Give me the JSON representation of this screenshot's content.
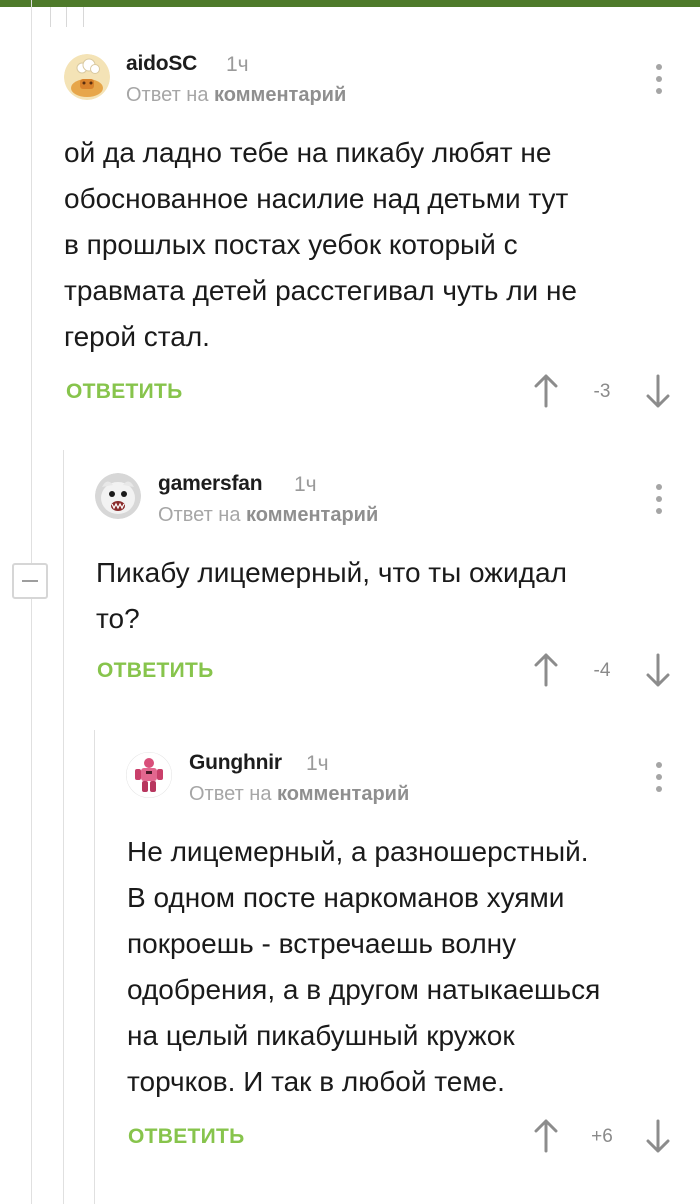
{
  "comments": [
    {
      "username": "aidoSC",
      "time": "1ч",
      "reply_prefix": "Ответ на",
      "reply_target": "комментарий",
      "text": "ой да ладно тебе на пикабу любят не\nобоснованное насилие над детьми тут\nв прошлых постах уебок который с\nтравмата детей расстегивал чуть ли не\nгерой стал.",
      "reply_label": "ОТВЕТИТЬ",
      "rating": "-3"
    },
    {
      "username": "gamersfan",
      "time": "1ч",
      "reply_prefix": "Ответ на",
      "reply_target": "комментарий",
      "text": "Пикабу лицемерный, что ты ожидал\nто?",
      "reply_label": "ОТВЕТИТЬ",
      "rating": "-4"
    },
    {
      "username": "Gunghnir",
      "time": "1ч",
      "reply_prefix": "Ответ на",
      "reply_target": "комментарий",
      "text": "Не лицемерный, а разношерстный.\nВ одном посте наркоманов хуями\nпокроешь - встречаешь волну\nодобрения, а в другом натыкаешься\nна целый пикабушный кружок\nторчков. И так в любой теме.",
      "reply_label": "ОТВЕТИТЬ",
      "rating": "+6"
    }
  ],
  "colors": {
    "accent_bar": "#4e7a2a",
    "reply_green": "#87c44c",
    "muted_text": "#9a9a9a"
  },
  "icons": {
    "menu": "more-vertical-icon",
    "upvote": "arrow-up-icon",
    "downvote": "arrow-down-icon",
    "collapse": "minus-icon"
  }
}
